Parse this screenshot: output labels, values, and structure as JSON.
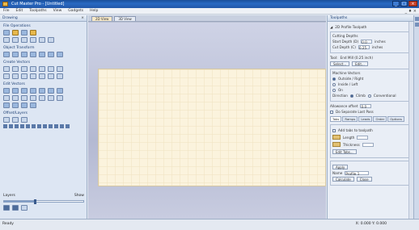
{
  "window": {
    "title": "Cut Master Pro - [Untitled]",
    "minimize": "_",
    "maximize": "□",
    "close": "×"
  },
  "menu": {
    "items": [
      "File",
      "Edit",
      "Toolpaths",
      "View",
      "Gadgets",
      "Help"
    ],
    "right": "_ ♦ ×"
  },
  "left_panel": {
    "header": "Drawing",
    "close": "×",
    "sections": [
      "File Operations",
      "Object Transform",
      "Create Vectors",
      "Edit Vectors",
      "Offset/Layers"
    ],
    "footer": {
      "left_label": "Layers",
      "right_label": "Show",
      "slider_value": 0.4
    }
  },
  "doc_tabs": [
    "2D View",
    "3D View"
  ],
  "right_panel": {
    "header": "Toolpaths",
    "title": "2D Profile Toolpath",
    "cutting_depths": "Cutting Depths",
    "start_depth_label": "Start Depth (D)",
    "start_depth": "0.0",
    "cut_depth_label": "Cut Depth (C)",
    "cut_depth": "0.25",
    "unit": "inches",
    "tool_label": "Tool:",
    "tool_value": "End Mill (0.25 inch)",
    "select_btn": "Select...",
    "edit_btn": "Edit...",
    "machine_vectors": "Machine Vectors",
    "outside": "Outside / Right",
    "inside": "Inside / Left",
    "on": "On",
    "direction": "Direction",
    "climb": "Climb",
    "conventional": "Conventional",
    "allowance": "Allowance offset",
    "allowance_value": "0.0",
    "separate": "Do Separate Last Pass",
    "subtabs": [
      "Tabs",
      "Ramps",
      "Leads",
      "Order",
      "Options"
    ],
    "add_tabs": "Add tabs to toolpath",
    "edit_tabs": "Edit Tabs...",
    "length_label": "Length",
    "thickness_label": "Thickness",
    "apply": "Apply",
    "name_label": "Name",
    "name_value": "Profile 1",
    "calc": "Calculate",
    "close": "Close"
  },
  "status": {
    "left": "Ready",
    "right": "X: 0.000  Y: 0.000"
  }
}
